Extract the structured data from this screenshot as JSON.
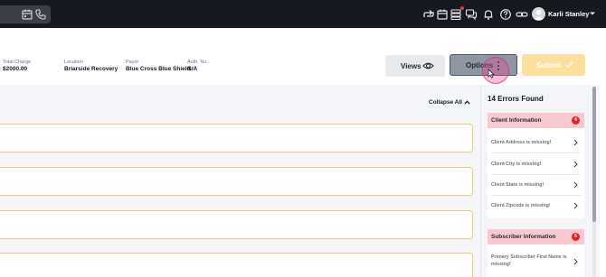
{
  "topbar": {
    "user": {
      "name": "Karli Stanley"
    },
    "icons": [
      "calendar-icon",
      "phone-icon",
      "share-icon",
      "calendar-icon",
      "list-icon",
      "chat-icon",
      "bell-icon",
      "help-icon",
      "link-icon"
    ]
  },
  "header": {
    "fields": [
      {
        "label": "Total Charge",
        "value": "$2000.00"
      },
      {
        "label": "Location",
        "value": "Briarside Recovery"
      },
      {
        "label": "Payor",
        "value": "Blue Cross Blue Shield"
      },
      {
        "label": "Auth. No.",
        "value": "N/A"
      }
    ],
    "buttons": {
      "views": "Views",
      "options": "Options",
      "submit": "Submit"
    }
  },
  "content": {
    "collapse_all": "Collapse All",
    "sections_visible": 4
  },
  "errors_panel": {
    "title": "14 Errors Found",
    "groups": [
      {
        "title": "Client Information",
        "count": "4",
        "items": [
          "Client Address is missing!",
          "Client City is missing!",
          "Client State is missing!",
          "Client Zipcode is missing!"
        ]
      },
      {
        "title": "Subscriber Information",
        "count": "6",
        "items": [
          "Primary Subscriber First Name is missing!"
        ]
      }
    ]
  },
  "colors": {
    "topbar": "#16191f",
    "submit_disabled": "#fcdf9d",
    "section_border": "#f3cb6a",
    "error_group_header": "#f8c9cf",
    "error_badge": "#e02424",
    "options_button": "#8f96a1"
  }
}
